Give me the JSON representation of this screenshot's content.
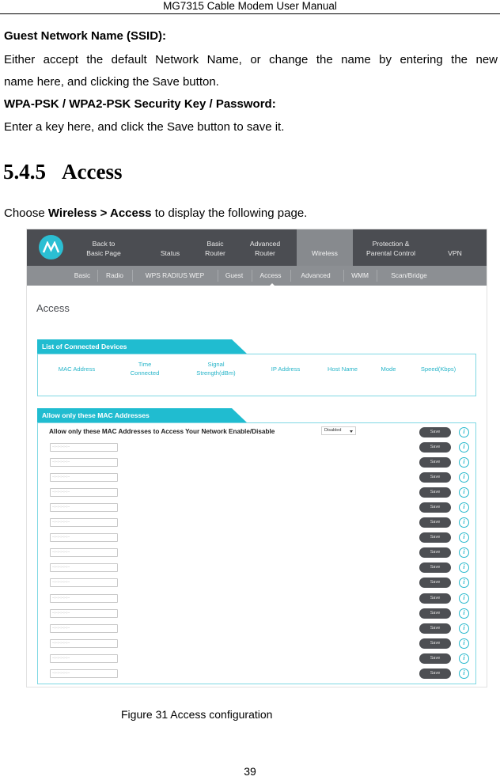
{
  "header": {
    "title": "MG7315 Cable Modem User Manual"
  },
  "body": {
    "guest_ssid_heading": "Guest Network Name (SSID):",
    "guest_ssid_line1": "Either accept the default Network Name, or change the name by entering the new",
    "guest_ssid_line2": "name here, and clicking the Save button.",
    "wpa_heading": "WPA-PSK / WPA2-PSK Security Key / Password:",
    "wpa_text": "Enter a key here, and click the Save button to save it.",
    "section_number": "5.4.5",
    "section_title": "Access",
    "choose_prefix": "Choose ",
    "choose_path": "Wireless > Access",
    "choose_suffix": " to display the following page."
  },
  "screenshot": {
    "brand_color": "#20bcd0",
    "top_nav": [
      {
        "line1": "Back to",
        "line2": "Basic Page",
        "active": false
      },
      {
        "line1": "",
        "line2": "Status",
        "active": false
      },
      {
        "line1": "Basic",
        "line2": "Router",
        "active": false
      },
      {
        "line1": "Advanced",
        "line2": "Router",
        "active": false
      },
      {
        "line1": "",
        "line2": "Wireless",
        "active": true
      },
      {
        "line1": "Protection &",
        "line2": "Parental Control",
        "active": false
      },
      {
        "line1": "",
        "line2": "VPN",
        "active": false
      }
    ],
    "sub_nav": [
      "Basic",
      "Radio",
      "WPS RADIUS WEP",
      "Guest",
      "Access",
      "Advanced",
      "WMM",
      "Scan/Bridge"
    ],
    "sub_nav_active": "Access",
    "page_title": "Access",
    "connected_devices": {
      "title": "List of Connected Devices",
      "columns": [
        {
          "line1": "MAC Address",
          "line2": ""
        },
        {
          "line1": "Time",
          "line2": "Connected"
        },
        {
          "line1": "Signal",
          "line2": "Strength(dBm)"
        },
        {
          "line1": "IP Address",
          "line2": ""
        },
        {
          "line1": "Host Name",
          "line2": ""
        },
        {
          "line1": "Mode",
          "line2": ""
        },
        {
          "line1": "Speed(Kbps)",
          "line2": ""
        }
      ],
      "rows": []
    },
    "mac_filter": {
      "title": "Allow only these MAC Addresses",
      "enable_label": "Allow only these MAC Addresses to Access Your Network Enable/Disable",
      "enable_value": "Disabled",
      "save_label": "Save",
      "info_glyph": "i",
      "entries": [
        {
          "placeholder": "--:--:--:--:--:--"
        },
        {
          "placeholder": "--:--:--:--:--:--"
        },
        {
          "placeholder": "--:--:--:--:--:--"
        },
        {
          "placeholder": "--:--:--:--:--:--"
        },
        {
          "placeholder": "--:--:--:--:--:--"
        },
        {
          "placeholder": "--:--:--:--:--:--"
        },
        {
          "placeholder": "--:--:--:--:--:--"
        },
        {
          "placeholder": "--:--:--:--:--:--"
        },
        {
          "placeholder": "--:--:--:--:--:--"
        },
        {
          "placeholder": "--:--:--:--:--:--"
        },
        {
          "placeholder": "--:--:--:--:--:--"
        },
        {
          "placeholder": "--:--:--:--:--:--"
        },
        {
          "placeholder": "--:--:--:--:--:--"
        },
        {
          "placeholder": "--:--:--:--:--:--"
        },
        {
          "placeholder": "--:--:--:--:--:--"
        },
        {
          "placeholder": "--:--:--:--:--:--"
        }
      ]
    }
  },
  "caption": "Figure 31 Access configuration",
  "page_number": "39"
}
